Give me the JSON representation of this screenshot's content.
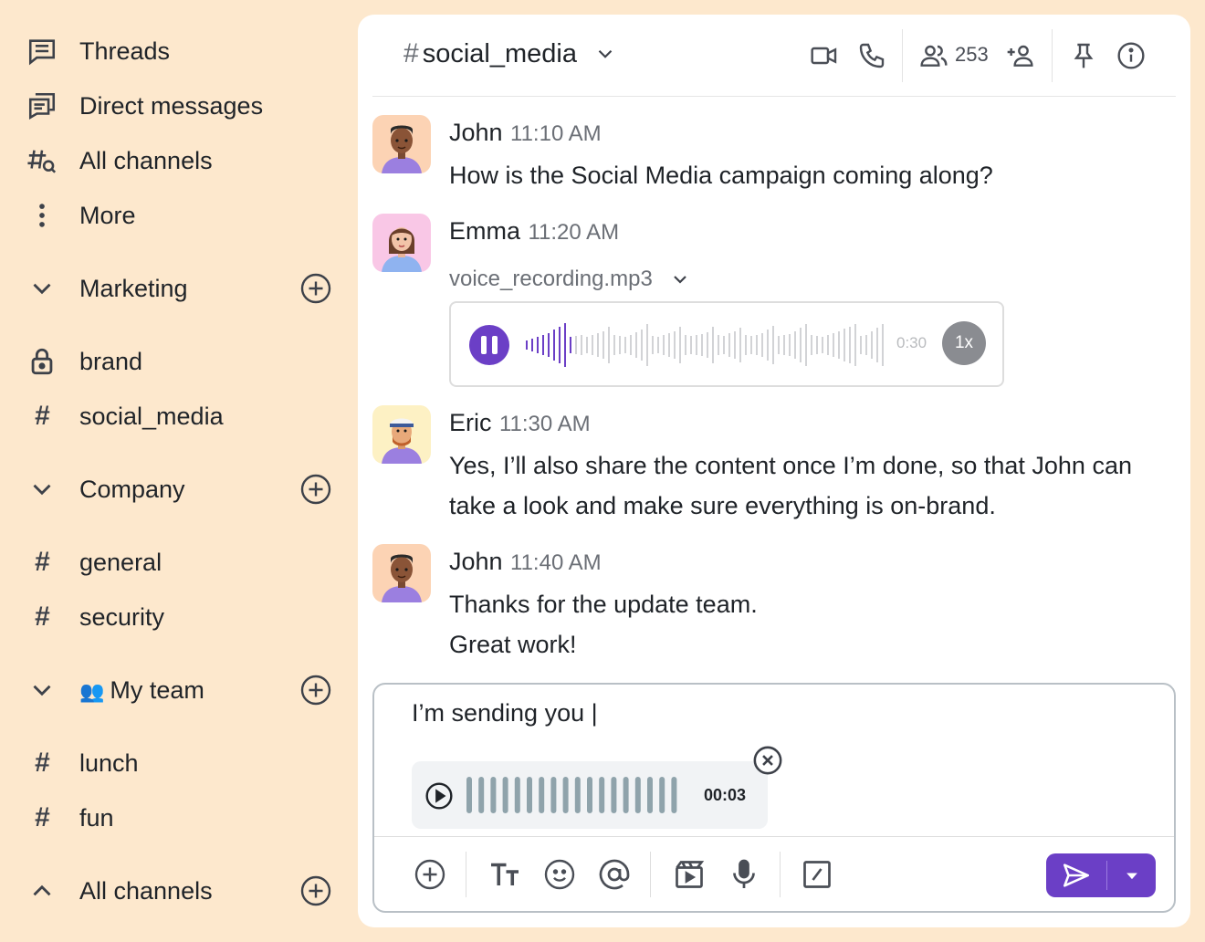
{
  "sidebar": {
    "nav": [
      {
        "label": "Threads",
        "icon": "threads-icon"
      },
      {
        "label": "Direct messages",
        "icon": "direct-messages-icon"
      },
      {
        "label": "All channels",
        "icon": "channel-search-icon"
      },
      {
        "label": "More",
        "icon": "more-vertical-icon"
      }
    ],
    "sections": [
      {
        "label": "Marketing",
        "channels": [
          "brand",
          "social_media"
        ]
      },
      {
        "label": "Company",
        "channels": [
          "general",
          "security"
        ]
      },
      {
        "label": "My team",
        "emoji": "👥",
        "channels": [
          "lunch",
          "fun"
        ]
      },
      {
        "label": "All channels",
        "channels": []
      }
    ]
  },
  "header": {
    "hash": "#",
    "channel": "social_media",
    "member_count": "253"
  },
  "messages": [
    {
      "author": "John",
      "time": "11:10 AM",
      "text": "How is the Social Media campaign coming along?"
    },
    {
      "author": "Emma",
      "time": "11:20 AM",
      "attachment": "voice_recording.mp3",
      "audio_duration": "0:30",
      "speed": "1x"
    },
    {
      "author": "Eric",
      "time": "11:30 AM",
      "line1": "Yes, I’ll also share the content once I’m done, so that John can",
      "line2": "take a look and make sure everything is on-brand."
    },
    {
      "author": "John",
      "time": "11:40 AM",
      "line1": "Thanks for the update team.",
      "line2": "Great work!"
    }
  ],
  "composer": {
    "text": "I’m sending you |",
    "attachment_duration": "00:03"
  },
  "colors": {
    "background": "#fde8cd",
    "accent": "#6b3fc6",
    "panel": "#ffffff"
  }
}
